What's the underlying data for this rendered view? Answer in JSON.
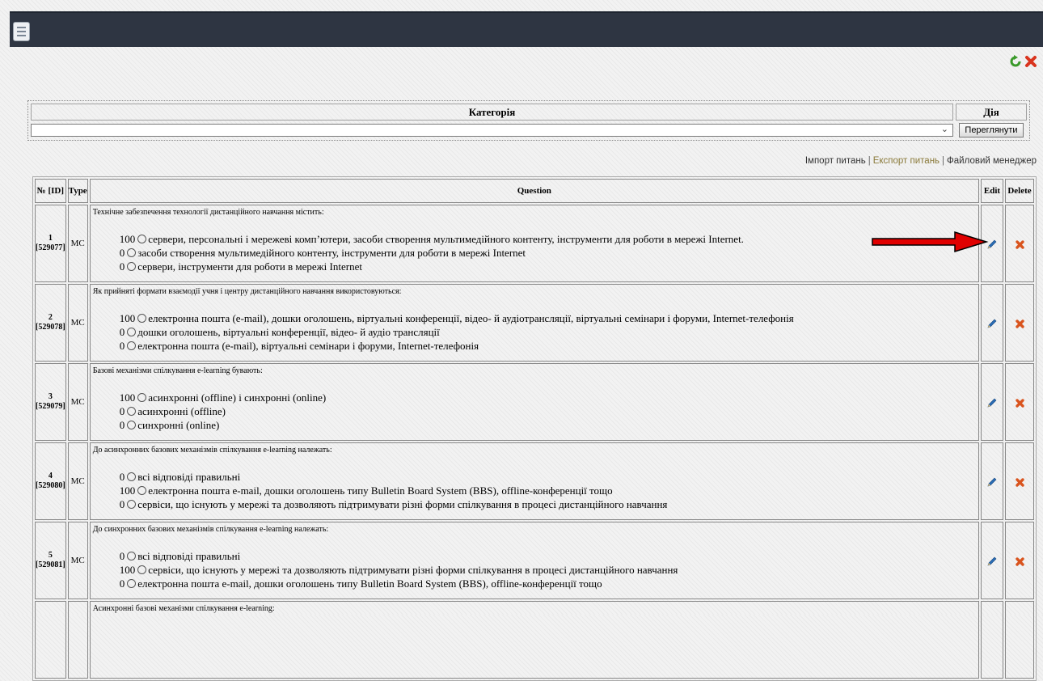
{
  "category": {
    "header": "Категорія",
    "action_header": "Дія",
    "selected": "",
    "view_button": "Переглянути"
  },
  "links": {
    "import": "Імпорт питань",
    "export": "Експорт питань",
    "file_manager": "Файловий менеджер"
  },
  "table": {
    "headers": {
      "number": "№ [ID]",
      "type": "Type",
      "question": "Question",
      "edit": "Edit",
      "delete": "Delete"
    },
    "rows": [
      {
        "num": "1",
        "id": "[529077]",
        "type": "MC",
        "question": "Технічне забезпечення технології дистанційного навчання містить:",
        "answers": [
          {
            "score": "100",
            "text": "сервери, персональні і мережеві комп’ютери, засоби створення мультимедійного контенту, інструменти для роботи в мережі Internet."
          },
          {
            "score": "0",
            "text": "засоби створення мультимедійного контенту, інструменти для роботи в мережі Internet"
          },
          {
            "score": "0",
            "text": "сервери, інструменти для роботи в мережі Internet"
          }
        ]
      },
      {
        "num": "2",
        "id": "[529078]",
        "type": "MC",
        "question": "Як прийняті формати взаємодії учня і центру дистанційного навчання використовуються:",
        "answers": [
          {
            "score": "100",
            "text": "електронна пошта (e-mail), дошки оголошень, віртуальні конференції, відео- й аудіотрансляції, віртуальні семінари і форуми, Internet-телефонія"
          },
          {
            "score": "0",
            "text": "дошки оголошень, віртуальні конференції, відео- й аудіо трансляції"
          },
          {
            "score": "0",
            "text": "електронна пошта (e-mail), віртуальні семінари і форуми, Internet-телефонія"
          }
        ]
      },
      {
        "num": "3",
        "id": "[529079]",
        "type": "MC",
        "question": "Базові механізми спілкування e-learning бувають:",
        "answers": [
          {
            "score": "100",
            "text": "асинхронні (offline) і синхронні (online)"
          },
          {
            "score": "0",
            "text": "асинхронні (offline)"
          },
          {
            "score": "0",
            "text": "синхронні (online)"
          }
        ]
      },
      {
        "num": "4",
        "id": "[529080]",
        "type": "MC",
        "question": "До асинхронних базових механізмів спілкування e-learning належать:",
        "answers": [
          {
            "score": "0",
            "text": "всі відповіді правильні"
          },
          {
            "score": "100",
            "text": "електронна пошта e-mail, дошки оголошень типу Bulletin Board System (BBS), offline-конференції тощо"
          },
          {
            "score": "0",
            "text": "сервіси, що існують у мережі та дозволяють підтримувати різні форми спілкування в процесі дистанційного навчання"
          }
        ]
      },
      {
        "num": "5",
        "id": "[529081]",
        "type": "MC",
        "question": "До синхронних базових механізмів спілкування e-learning належать:",
        "answers": [
          {
            "score": "0",
            "text": "всі відповіді правильні"
          },
          {
            "score": "100",
            "text": "сервіси, що існують у мережі та дозволяють підтримувати різні форми спілкування в процесі дистанційного навчання"
          },
          {
            "score": "0",
            "text": "електронна пошта e-mail, дошки оголошень типу Bulletin Board System (BBS), offline-конференції тощо"
          }
        ]
      },
      {
        "num": "",
        "id": "",
        "type": "",
        "question": "Асинхронні базові механізми спілкування e-learning:",
        "answers": []
      }
    ]
  },
  "colors": {
    "topbar": "#2e3542",
    "delete_icon": "#d9541e",
    "edit_icon": "#2a6db5",
    "arrow": "#e00000"
  },
  "icons": {
    "menu": "menu-icon",
    "refresh": "refresh-icon",
    "close": "close-icon",
    "edit": "pencil-icon",
    "delete": "delete-icon"
  }
}
